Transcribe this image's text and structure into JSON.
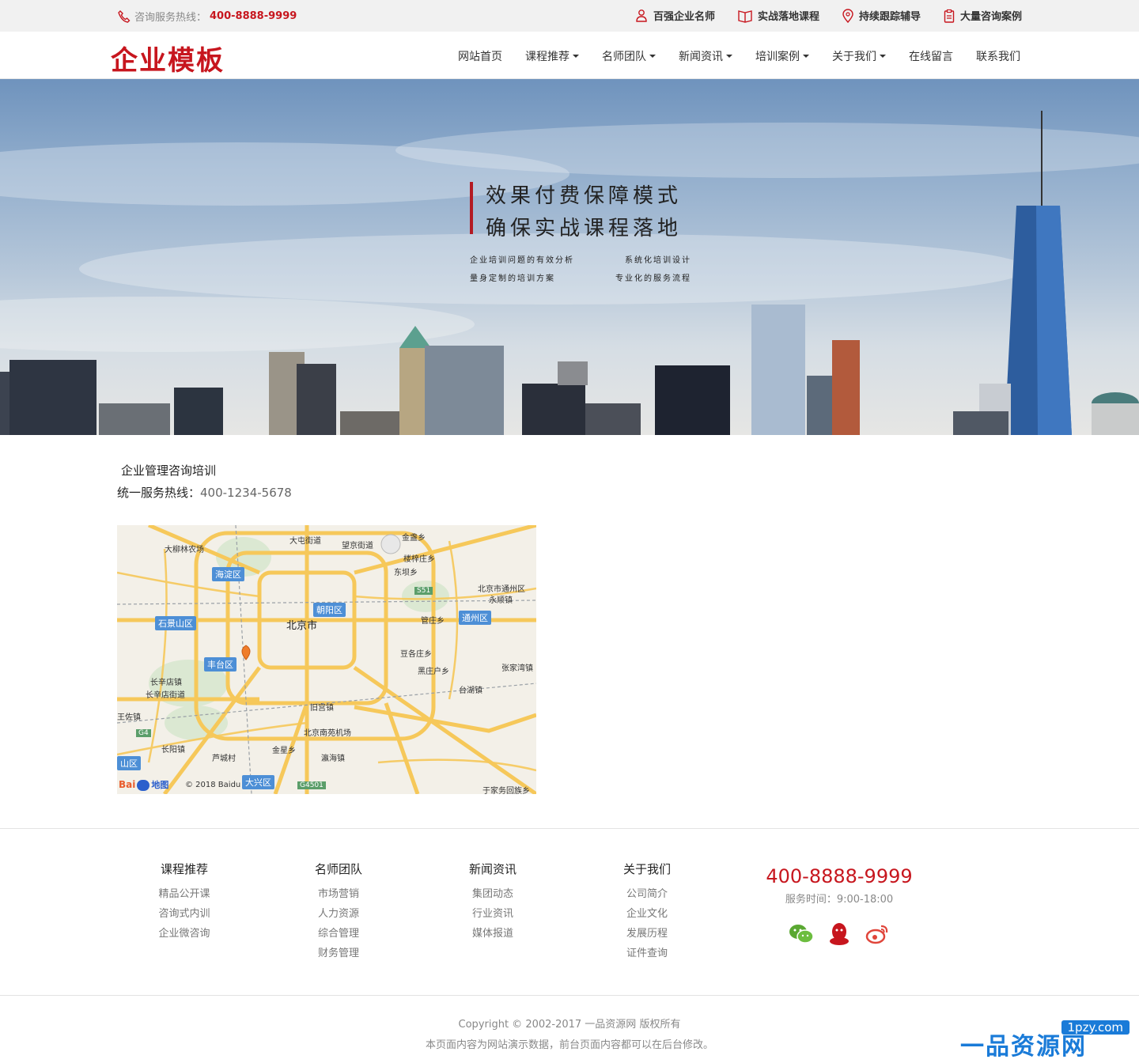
{
  "topbar": {
    "hotline_label": "咨询服务热线：",
    "hotline_number": "400-8888-9999",
    "features": [
      {
        "icon": "person-icon",
        "label": "百强企业名师"
      },
      {
        "icon": "book-icon",
        "label": "实战落地课程"
      },
      {
        "icon": "location-pin-icon",
        "label": "持续跟踪辅导"
      },
      {
        "icon": "clipboard-icon",
        "label": "大量咨询案例"
      }
    ]
  },
  "header": {
    "logo": "企业模板",
    "nav": [
      {
        "label": "网站首页",
        "dropdown": false
      },
      {
        "label": "课程推荐",
        "dropdown": true
      },
      {
        "label": "名师团队",
        "dropdown": true
      },
      {
        "label": "新闻资讯",
        "dropdown": true
      },
      {
        "label": "培训案例",
        "dropdown": true
      },
      {
        "label": "关于我们",
        "dropdown": true
      },
      {
        "label": "在线留言",
        "dropdown": false
      },
      {
        "label": "联系我们",
        "dropdown": false
      }
    ]
  },
  "banner": {
    "line1": "效果付费保障模式",
    "line2": "确保实战课程落地",
    "subs": [
      "企业培训问题的有效分析",
      "系统化培训设计",
      "量身定制的培训方案",
      "专业化的服务流程"
    ]
  },
  "contact_section": {
    "company": "企业管理咨询培训",
    "hotline_label": "统一服务热线：",
    "hotline_value": "400-1234-5678"
  },
  "map": {
    "city": "北京市",
    "districts": [
      "海淀区",
      "朝阳区",
      "石景山区",
      "丰台区",
      "通州区",
      "大兴区",
      "山区"
    ],
    "places": [
      "大柳林农场",
      "大屯街道",
      "望京街道",
      "金盏乡",
      "楼梓庄乡",
      "东坝乡",
      "北京市通州区",
      "永顺镇",
      "管庄乡",
      "豆各庄乡",
      "张家湾镇",
      "黑庄户乡",
      "台湖镇",
      "长辛店镇",
      "长辛店街道",
      "旧宫镇",
      "王佐镇",
      "北京南苑机场",
      "长阳镇",
      "金星乡",
      "瀛海镇",
      "芦城村",
      "于家务回族乡"
    ],
    "roads": [
      "S51",
      "G4",
      "G4501"
    ],
    "logo_text": "Bai",
    "logo_suffix": "地图",
    "copyright": "© 2018 Baidu"
  },
  "footer": {
    "columns": [
      {
        "title": "课程推荐",
        "links": [
          "精品公开课",
          "咨询式内训",
          "企业微咨询"
        ]
      },
      {
        "title": "名师团队",
        "links": [
          "市场营销",
          "人力资源",
          "综合管理",
          "财务管理"
        ]
      },
      {
        "title": "新闻资讯",
        "links": [
          "集团动态",
          "行业资讯",
          "媒体报道"
        ]
      },
      {
        "title": "关于我们",
        "links": [
          "公司简介",
          "企业文化",
          "发展历程",
          "证件查询"
        ]
      }
    ],
    "phone": "400-8888-9999",
    "hours": "服务时间：9:00-18:00",
    "social": [
      "wechat-icon",
      "qq-icon",
      "weibo-icon"
    ]
  },
  "bottom": {
    "copyright": "Copyright © 2002-2017 一品资源网 版权所有",
    "notice": "本页面内容为网站演示数据，前台页面内容都可以在后台修改。",
    "watermark_main": "一品资源网",
    "watermark_url": "1pzy.com"
  },
  "colors": {
    "brand_red": "#c7161e",
    "map_road": "#f6c85a",
    "district_blue": "#4d8fd6",
    "watermark_blue": "#1a7bd8"
  }
}
